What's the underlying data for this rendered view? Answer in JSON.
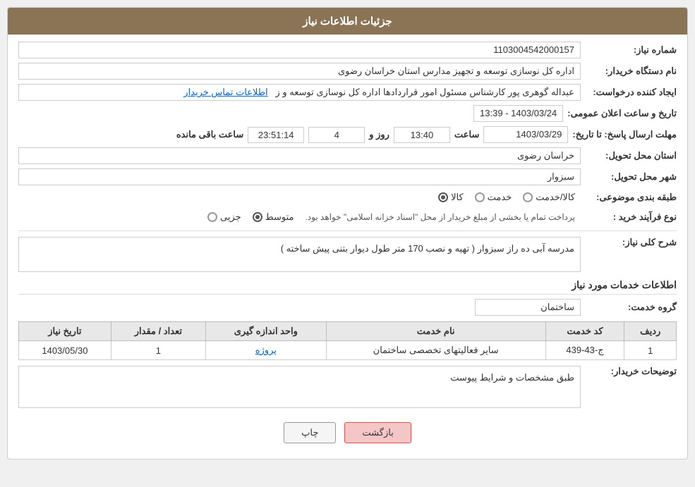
{
  "header": {
    "title": "جزئیات اطلاعات نیاز"
  },
  "fields": {
    "need_number_label": "شماره نیاز:",
    "need_number_value": "1103004542000157",
    "buyer_org_label": "نام دستگاه خریدار:",
    "buyer_org_value": "اداره کل نوسازی  توسعه و تجهیز مدارس استان خراسان رضوی",
    "creator_label": "ایجاد کننده درخواست:",
    "creator_value": "عبداله گوهری پور کارشناس مسئول امور قراردادها  اداره کل نوسازی  توسعه و ز",
    "creator_link": "اطلاعات تماس خریدار",
    "announcement_date_label": "تاریخ و ساعت اعلان عمومی:",
    "announcement_date_value": "1403/03/24 - 13:39",
    "deadline_label": "مهلت ارسال پاسخ: تا تاریخ:",
    "deadline_date": "1403/03/29",
    "deadline_time": "13:40",
    "deadline_days": "4",
    "deadline_countdown": "23:51:14",
    "deadline_remaining": "ساعت باقی مانده",
    "province_label": "استان محل تحویل:",
    "province_value": "خراسان رضوی",
    "city_label": "شهر محل تحویل:",
    "city_value": "سبزوار",
    "category_label": "طبقه بندی موضوعی:",
    "category_options": [
      {
        "label": "کالا",
        "selected": false
      },
      {
        "label": "خدمت",
        "selected": false
      },
      {
        "label": "کالا/خدمت",
        "selected": false
      }
    ],
    "purchase_type_label": "نوع فرآیند خرید :",
    "purchase_type_options": [
      {
        "label": "جزیی",
        "selected": false
      },
      {
        "label": "متوسط",
        "selected": true
      }
    ],
    "purchase_type_note": "پرداخت تمام یا بخشی از مبلغ خریدار از محل \"اسناد خزانه اسلامی\" خواهد بود.",
    "general_desc_label": "شرح کلی نیاز:",
    "general_desc_value": "مدرسه آبی ده راز سبزوار ( تهیه و نصب 170 متر طول دیوار بتنی پیش ساخته )",
    "services_section_title": "اطلاعات خدمات مورد نیاز",
    "service_group_label": "گروه خدمت:",
    "service_group_value": "ساختمان",
    "table": {
      "headers": [
        "ردیف",
        "کد خدمت",
        "نام خدمت",
        "واحد اندازه گیری",
        "تعداد / مقدار",
        "تاریخ نیاز"
      ],
      "rows": [
        {
          "index": "1",
          "service_code": "ج-43-439",
          "service_name": "سایر فعالیتهای تخصصی ساختمان",
          "unit": "پروژه",
          "quantity": "1",
          "date": "1403/05/30"
        }
      ]
    },
    "buyer_notes_label": "توضیحات خریدار:",
    "buyer_notes_value": "طبق مشخصات و شرایط پیوست"
  },
  "buttons": {
    "print": "چاپ",
    "back": "بازگشت"
  }
}
